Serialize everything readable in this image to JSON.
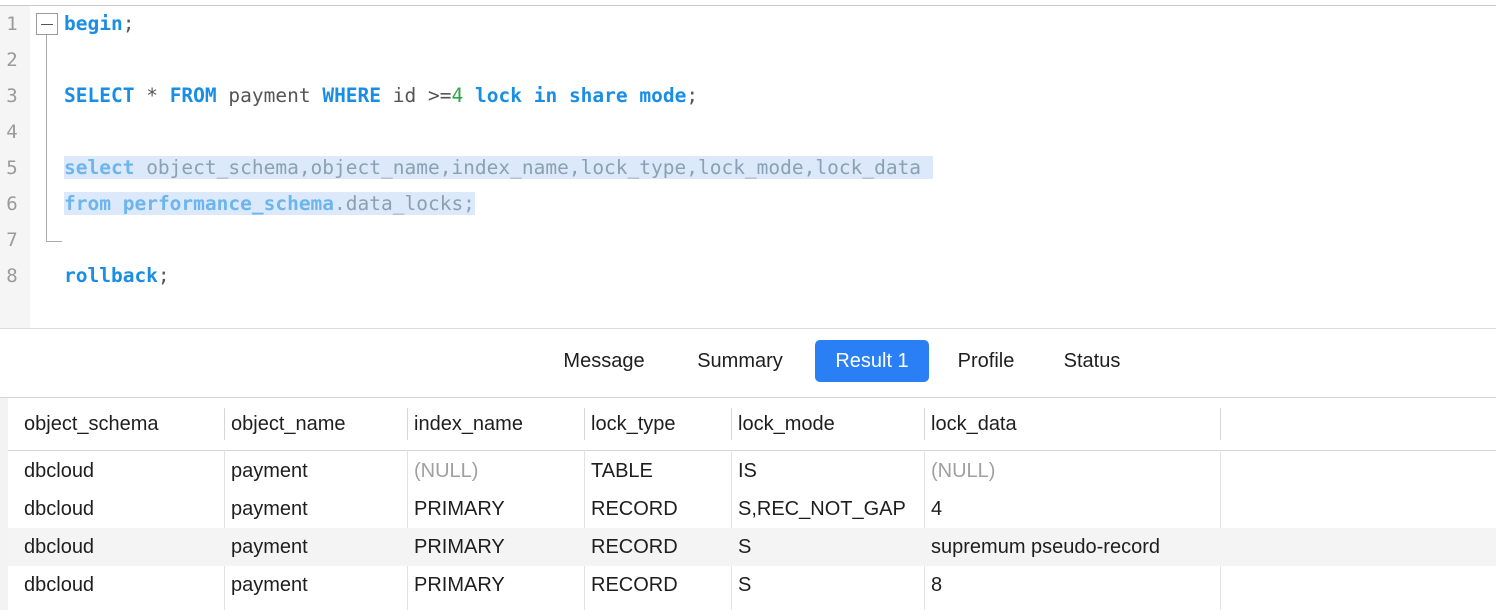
{
  "editor": {
    "lines": [
      {
        "n": "1",
        "tokens": [
          {
            "t": "begin",
            "c": "kw"
          },
          {
            "t": ";",
            "c": "p"
          }
        ]
      },
      {
        "n": "2",
        "tokens": []
      },
      {
        "n": "3",
        "tokens": [
          {
            "t": "SELECT",
            "c": "kw"
          },
          {
            "t": " * ",
            "c": "p"
          },
          {
            "t": "FROM",
            "c": "kw"
          },
          {
            "t": " payment ",
            "c": "p"
          },
          {
            "t": "WHERE",
            "c": "kw"
          },
          {
            "t": " id >=",
            "c": "p"
          },
          {
            "t": "4",
            "c": "num"
          },
          {
            "t": " ",
            "c": "p"
          },
          {
            "t": "lock",
            "c": "kw"
          },
          {
            "t": " ",
            "c": "p"
          },
          {
            "t": "in",
            "c": "kw"
          },
          {
            "t": " ",
            "c": "p"
          },
          {
            "t": "share",
            "c": "kw"
          },
          {
            "t": " ",
            "c": "p"
          },
          {
            "t": "mode",
            "c": "kw"
          },
          {
            "t": ";",
            "c": "p"
          }
        ]
      },
      {
        "n": "4",
        "tokens": []
      },
      {
        "n": "5",
        "sel": true,
        "tokens": [
          {
            "t": "select",
            "c": "kw"
          },
          {
            "t": " object_schema,object_name,index_name,lock_type,lock_mode,lock_data ",
            "c": "p"
          }
        ]
      },
      {
        "n": "6",
        "sel": true,
        "tokens": [
          {
            "t": "from",
            "c": "kw"
          },
          {
            "t": " ",
            "c": "p"
          },
          {
            "t": "performance_schema",
            "c": "kw"
          },
          {
            "t": ".data_locks;",
            "c": "p"
          }
        ]
      },
      {
        "n": "7",
        "tokens": []
      },
      {
        "n": "8",
        "tokens": [
          {
            "t": "rollback",
            "c": "kw"
          },
          {
            "t": ";",
            "c": "p"
          }
        ]
      }
    ]
  },
  "tabs": [
    {
      "label": "Message",
      "active": false
    },
    {
      "label": "Summary",
      "active": false
    },
    {
      "label": "Result 1",
      "active": true
    },
    {
      "label": "Profile",
      "active": false
    },
    {
      "label": "Status",
      "active": false
    }
  ],
  "grid": {
    "columns": [
      "object_schema",
      "object_name",
      "index_name",
      "lock_type",
      "lock_mode",
      "lock_data"
    ],
    "rows": [
      [
        "dbcloud",
        "payment",
        "(NULL)",
        "TABLE",
        "IS",
        "(NULL)"
      ],
      [
        "dbcloud",
        "payment",
        "PRIMARY",
        "RECORD",
        "S,REC_NOT_GAP",
        "4"
      ],
      [
        "dbcloud",
        "payment",
        "PRIMARY",
        "RECORD",
        "S",
        "supremum pseudo-record"
      ],
      [
        "dbcloud",
        "payment",
        "PRIMARY",
        "RECORD",
        "S",
        "8"
      ]
    ],
    "null_text": "(NULL)"
  }
}
